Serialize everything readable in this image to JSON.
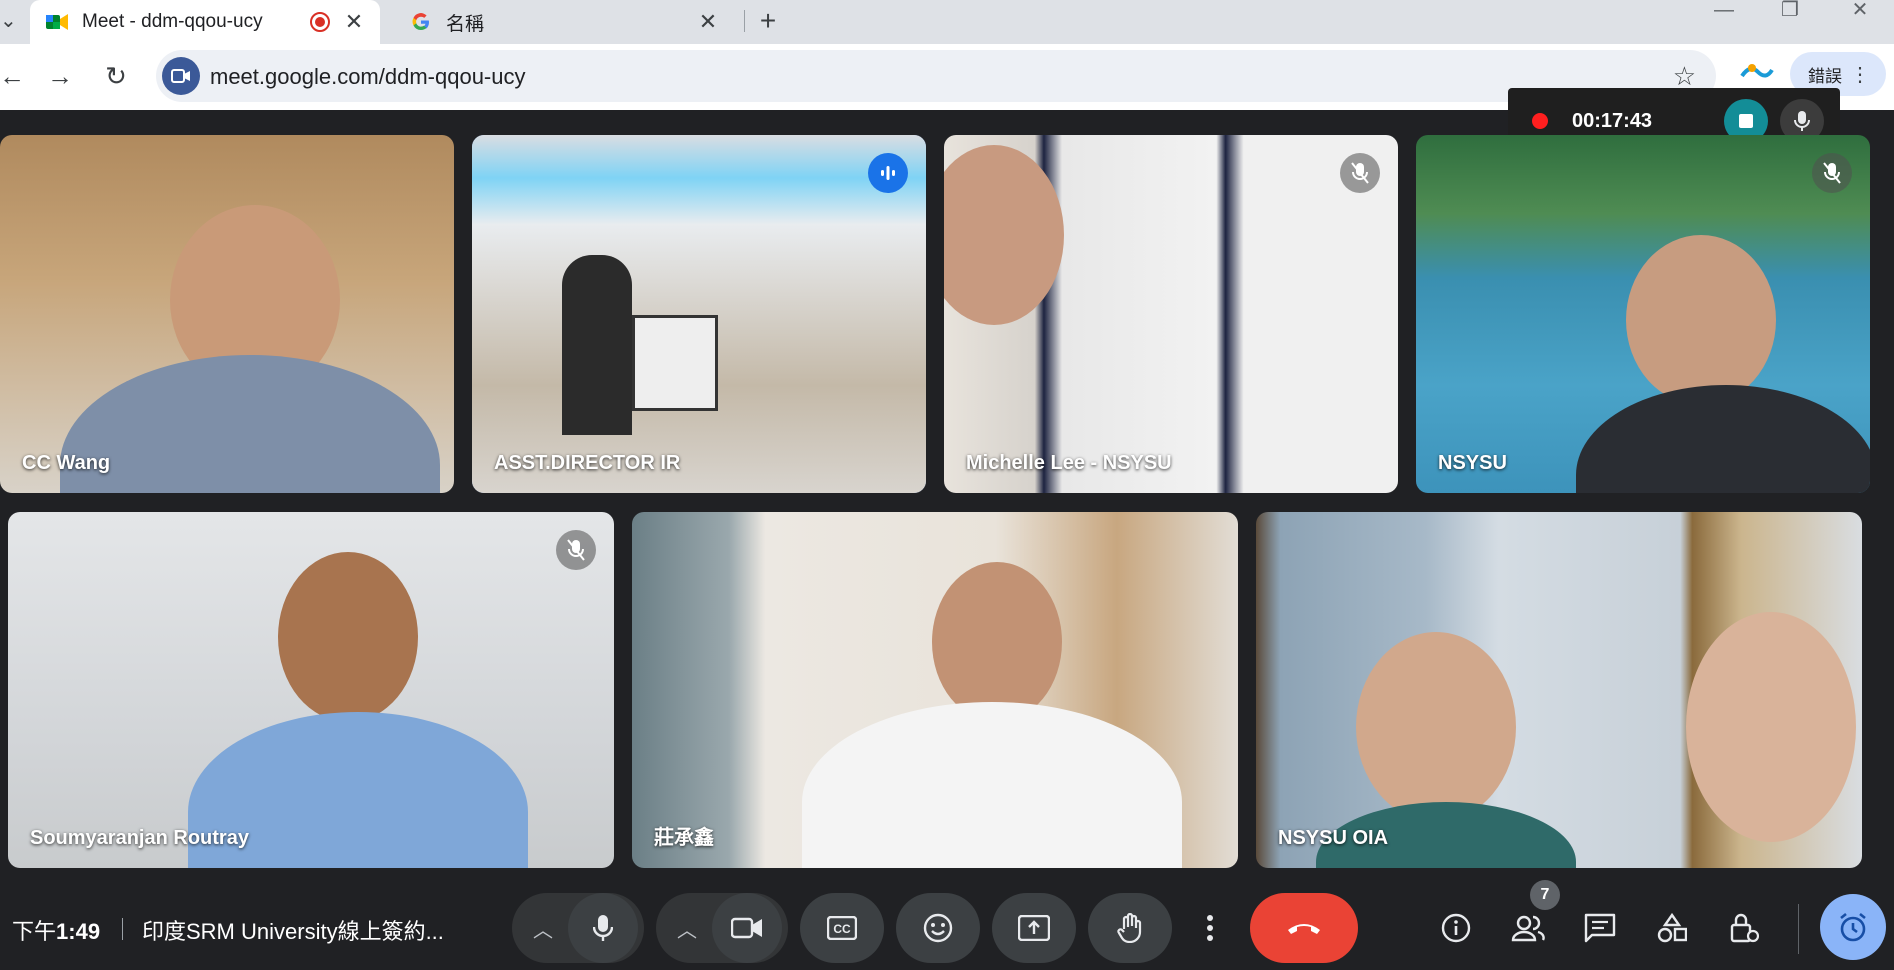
{
  "browser": {
    "tabs": [
      {
        "title": "Meet - ddm-qqou-ucy",
        "active": true
      },
      {
        "title": "名稱",
        "active": false
      }
    ],
    "new_tab": "+",
    "close_glyph": "✕",
    "url": "meet.google.com/ddm-qqou-ucy",
    "profile_label": "錯誤"
  },
  "recorder": {
    "elapsed": "00:17:43"
  },
  "participants": [
    {
      "name": "CC Wang",
      "muted": false,
      "speaking": false
    },
    {
      "name": "ASST.DIRECTOR IR",
      "muted": false,
      "speaking": true
    },
    {
      "name": "Michelle Lee - NSYSU",
      "muted": true,
      "speaking": false
    },
    {
      "name": "NSYSU",
      "muted": true,
      "speaking": false
    },
    {
      "name": "Soumyaranjan Routray",
      "muted": true,
      "speaking": false
    },
    {
      "name": "莊承鑫",
      "muted": false,
      "speaking": false
    },
    {
      "name": "NSYSU OIA",
      "muted": false,
      "speaking": false
    }
  ],
  "bottom_bar": {
    "time_prefix": "下午",
    "time": "1:49",
    "separator": "|",
    "meeting_title": "印度SRM University線上簽約...",
    "people_count": "7"
  },
  "colors": {
    "meet_bg": "#202124",
    "end_call": "#ea4335",
    "accent_blue": "#8ab4f8",
    "record_red": "#ff1f1f",
    "recorder_stop": "#138d97"
  }
}
